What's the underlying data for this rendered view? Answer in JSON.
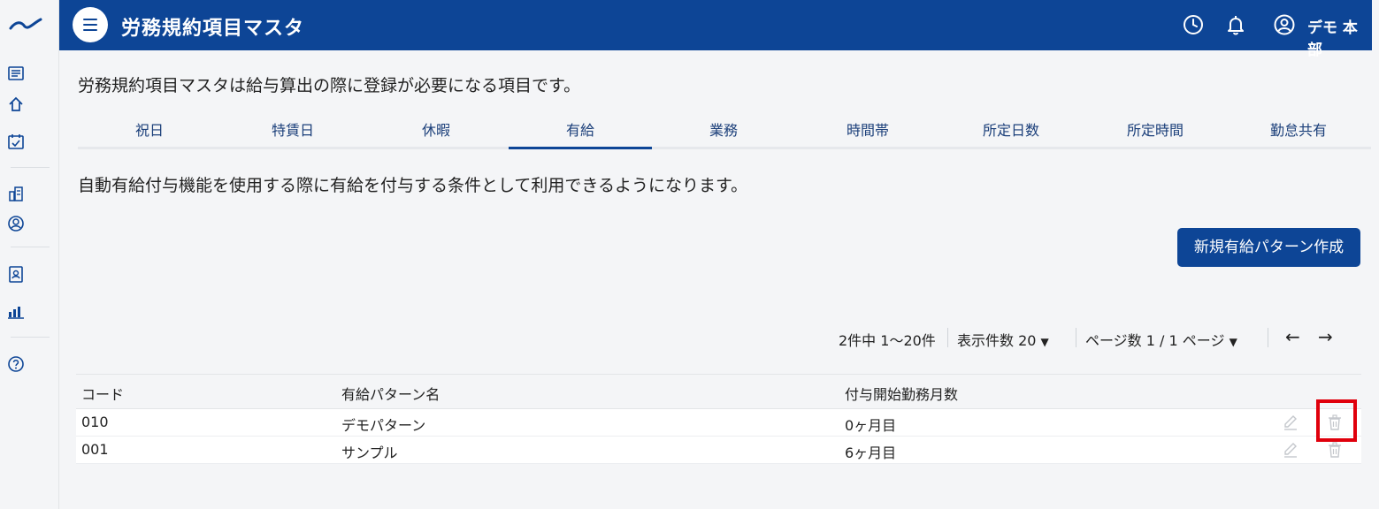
{
  "header": {
    "title": "労務規約項目マスタ",
    "user_name": "デモ 本部"
  },
  "sidebar": {
    "icons": [
      "list-icon",
      "home-icon",
      "calendar-check-icon",
      "building-icon",
      "user-circle-icon",
      "id-card-icon",
      "bar-chart-icon",
      "help-icon"
    ]
  },
  "page": {
    "description": "労務規約項目マスタは給与算出の際に登録が必要になる項目です。",
    "sub_description": "自動有給付与機能を使用する際に有給を付与する条件として利用できるようになります。",
    "create_button": "新規有給パターン作成"
  },
  "tabs": [
    {
      "label": "祝日"
    },
    {
      "label": "特賃日"
    },
    {
      "label": "休暇"
    },
    {
      "label": "有給",
      "active": true
    },
    {
      "label": "業務"
    },
    {
      "label": "時間帯"
    },
    {
      "label": "所定日数"
    },
    {
      "label": "所定時間"
    },
    {
      "label": "勤怠共有"
    }
  ],
  "pagination": {
    "count_text": "2件中 1〜20件",
    "per_page_text": "表示件数 20",
    "page_text": "ページ数 1 / 1 ページ",
    "prev": "←",
    "next": "→"
  },
  "table": {
    "columns": [
      "コード",
      "有給パターン名",
      "付与開始勤務月数"
    ],
    "rows": [
      {
        "code": "010",
        "name": "デモパターン",
        "months": "0ヶ月目"
      },
      {
        "code": "001",
        "name": "サンプル",
        "months": "6ヶ月目"
      }
    ]
  },
  "colors": {
    "brand": "#0d4596",
    "highlight": "#e0000c"
  }
}
